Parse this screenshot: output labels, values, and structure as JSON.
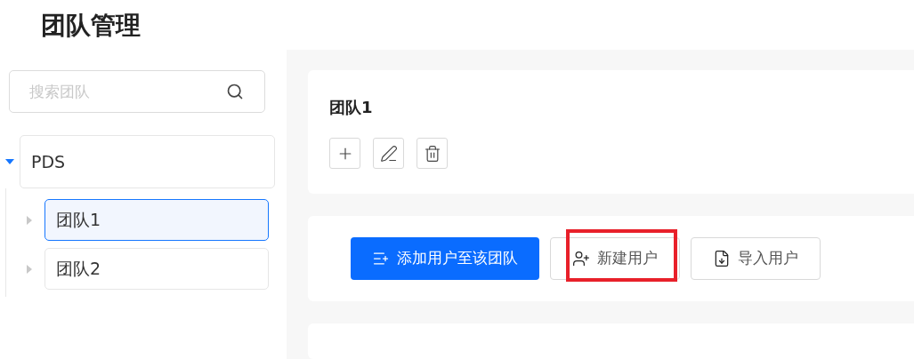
{
  "page_title": "团队管理",
  "search": {
    "placeholder": "搜索团队"
  },
  "tree": [
    {
      "label": "PDS",
      "expanded": true,
      "selected": false,
      "children": [
        {
          "label": "团队1",
          "expanded": false,
          "selected": true
        },
        {
          "label": "团队2",
          "expanded": false,
          "selected": false
        }
      ]
    }
  ],
  "team_card": {
    "title": "团队1",
    "tools": [
      {
        "kind": "add"
      },
      {
        "kind": "edit"
      },
      {
        "kind": "delete"
      }
    ]
  },
  "actions": [
    {
      "label": "添加用户至该团队",
      "kind": "add-to-team",
      "primary": true,
      "highlighted": false
    },
    {
      "label": "新建用户",
      "kind": "new-user",
      "primary": false,
      "highlighted": true
    },
    {
      "label": "导入用户",
      "kind": "import",
      "primary": false,
      "highlighted": false
    }
  ]
}
